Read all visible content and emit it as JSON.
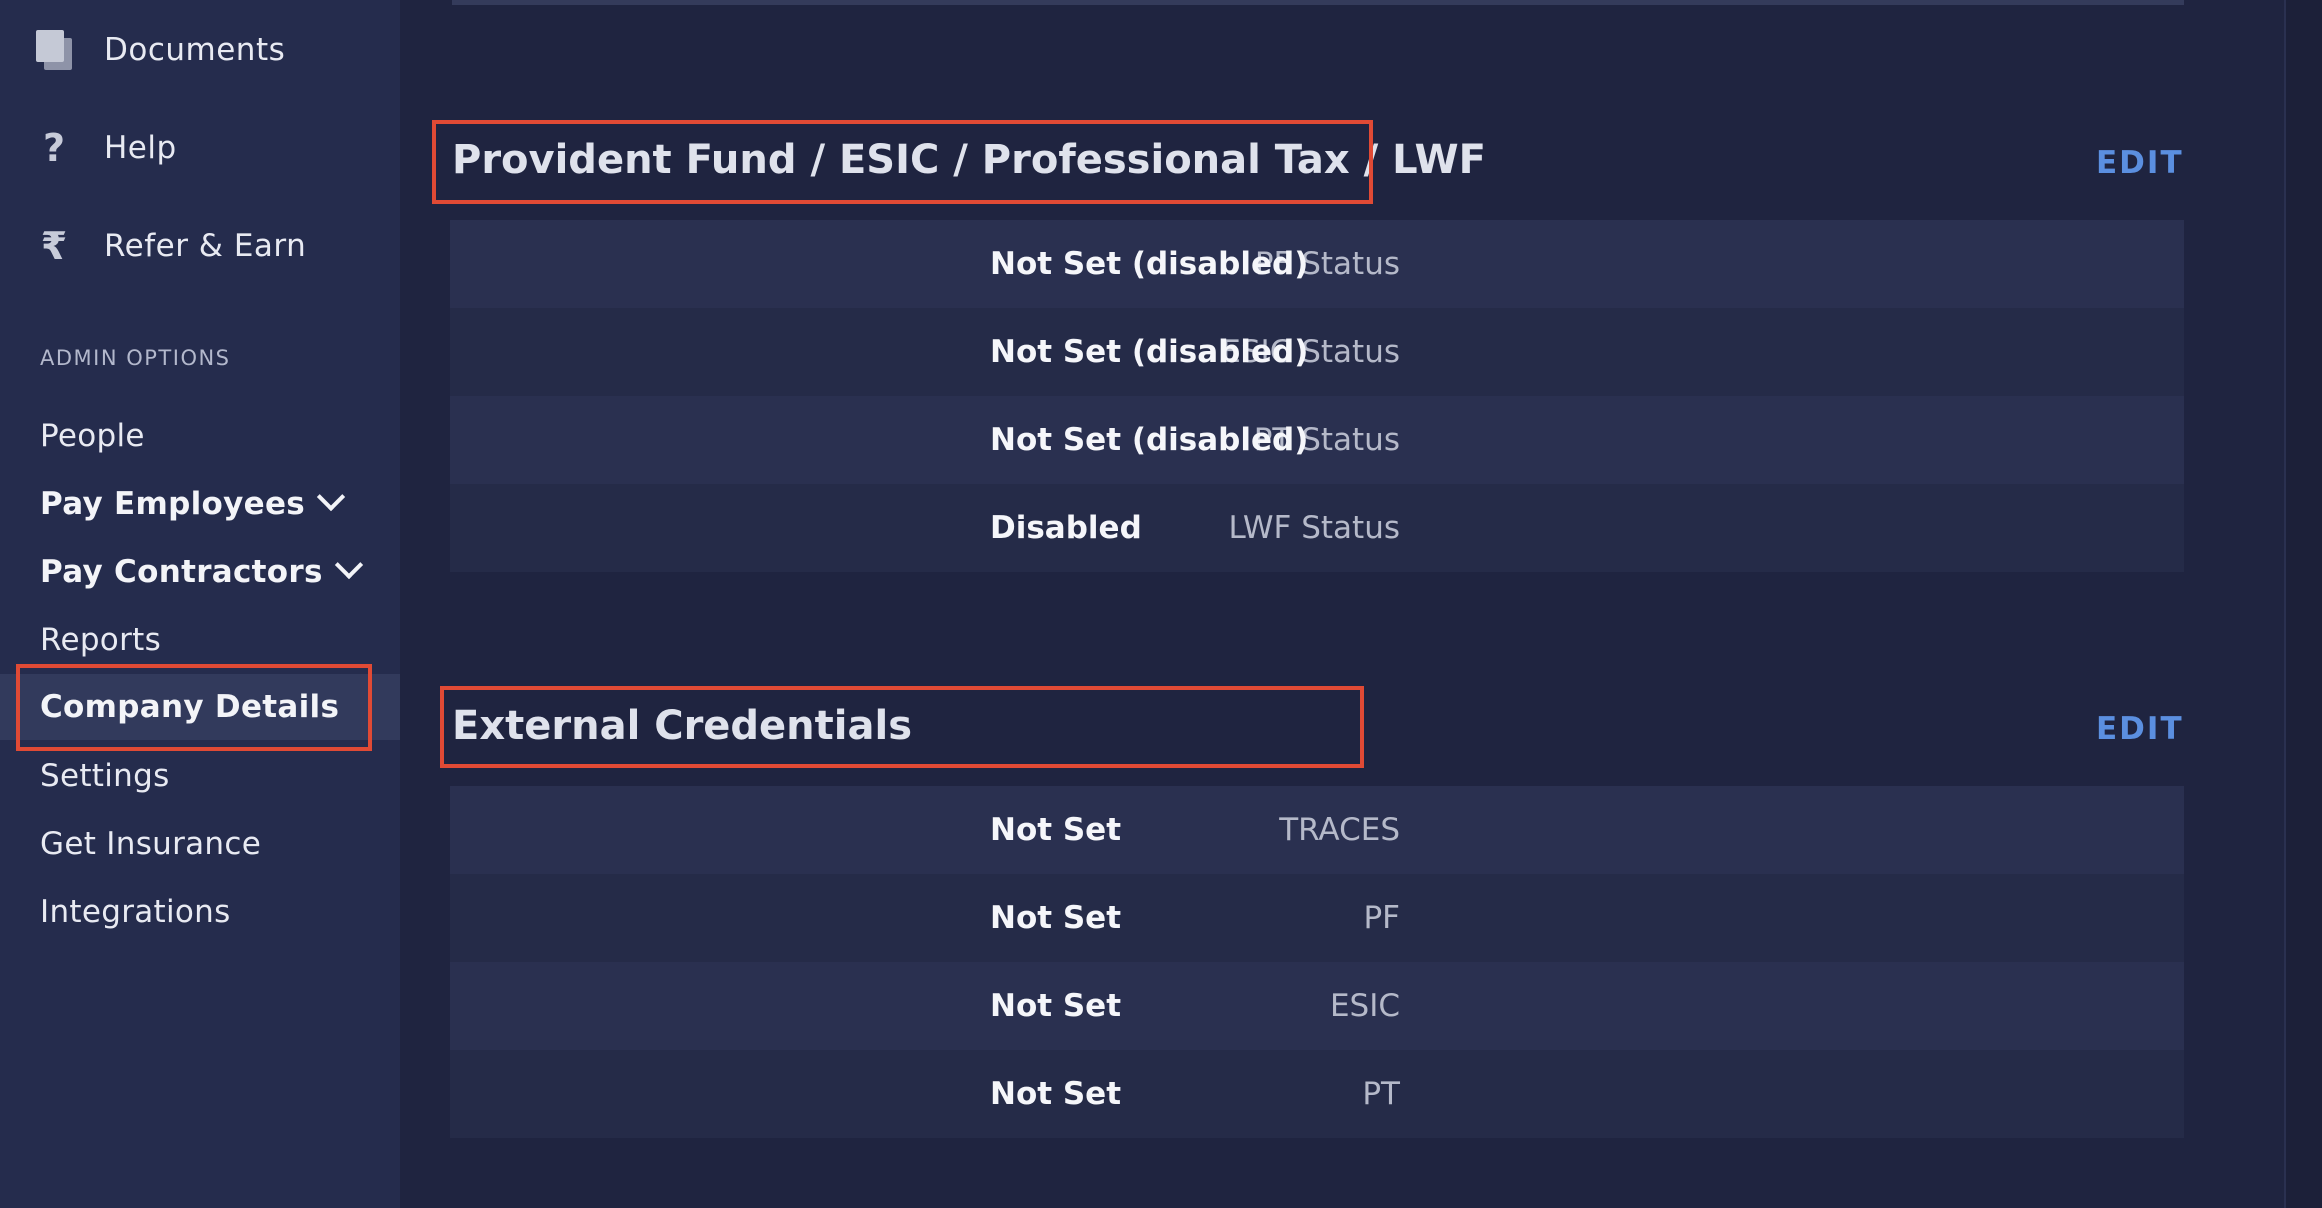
{
  "sidebar": {
    "top_items": [
      {
        "label": "Documents",
        "icon": "documents-icon"
      },
      {
        "label": "Help",
        "icon": "question-icon",
        "glyph": "?"
      },
      {
        "label": "Refer & Earn",
        "icon": "rupee-icon",
        "glyph": "₹"
      }
    ],
    "section_label": "ADMIN OPTIONS",
    "items": [
      {
        "label": "People"
      },
      {
        "label": "Pay Employees",
        "expandable": true
      },
      {
        "label": "Pay Contractors",
        "expandable": true
      },
      {
        "label": "Reports"
      },
      {
        "label": "Company Details",
        "active": true
      },
      {
        "label": "Settings"
      },
      {
        "label": "Get Insurance"
      },
      {
        "label": "Integrations"
      }
    ]
  },
  "main": {
    "statutory": {
      "title": "Provident Fund / ESIC / Professional Tax / LWF",
      "edit_label": "EDIT",
      "rows": [
        {
          "key": "PF Status",
          "value": "Not Set (disabled)"
        },
        {
          "key": "ESIC Status",
          "value": "Not Set (disabled)"
        },
        {
          "key": "PT Status",
          "value": "Not Set (disabled)"
        },
        {
          "key": "LWF Status",
          "value": "Disabled"
        }
      ]
    },
    "credentials": {
      "title": "External Credentials",
      "edit_label": "EDIT",
      "rows": [
        {
          "key": "TRACES",
          "value": "Not Set"
        },
        {
          "key": "PF",
          "value": "Not Set"
        },
        {
          "key": "ESIC",
          "value": "Not Set"
        },
        {
          "key": "PT",
          "value": "Not Set"
        }
      ]
    }
  },
  "colors": {
    "background": "#1f2440",
    "sidebar": "#252c4d",
    "accent_edit": "#5b8fe0",
    "highlight_box": "#e04a35"
  }
}
